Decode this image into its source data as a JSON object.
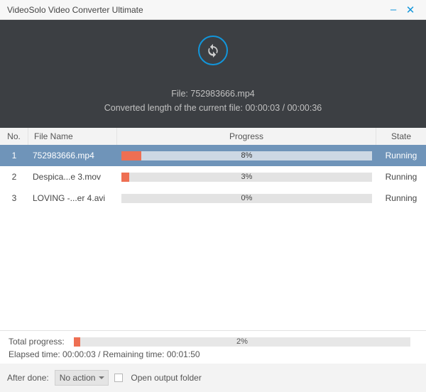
{
  "window": {
    "title": "VideoSolo Video Converter Ultimate"
  },
  "hero": {
    "file_label": "File:",
    "file_name": "752983666.mp4",
    "length_label": "Converted length of the current file:",
    "length_current": "00:00:03",
    "length_total": "00:00:36"
  },
  "columns": {
    "no": "No.",
    "file": "File Name",
    "progress": "Progress",
    "state": "State"
  },
  "rows": [
    {
      "no": "1",
      "name": "752983666.mp4",
      "percent": 8,
      "percent_label": "8%",
      "state": "Running",
      "selected": true
    },
    {
      "no": "2",
      "name": "Despica...e 3.mov",
      "percent": 3,
      "percent_label": "3%",
      "state": "Running",
      "selected": false
    },
    {
      "no": "3",
      "name": "LOVING -...er 4.avi",
      "percent": 0,
      "percent_label": "0%",
      "state": "Running",
      "selected": false
    }
  ],
  "totals": {
    "label": "Total progress:",
    "percent": 2,
    "percent_label": "2%",
    "elapsed_label": "Elapsed time:",
    "elapsed": "00:00:03",
    "remaining_label": "Remaining time:",
    "remaining": "00:01:50"
  },
  "footer": {
    "after_done_label": "After done:",
    "after_done_value": "No action",
    "open_output_label": "Open output folder"
  }
}
